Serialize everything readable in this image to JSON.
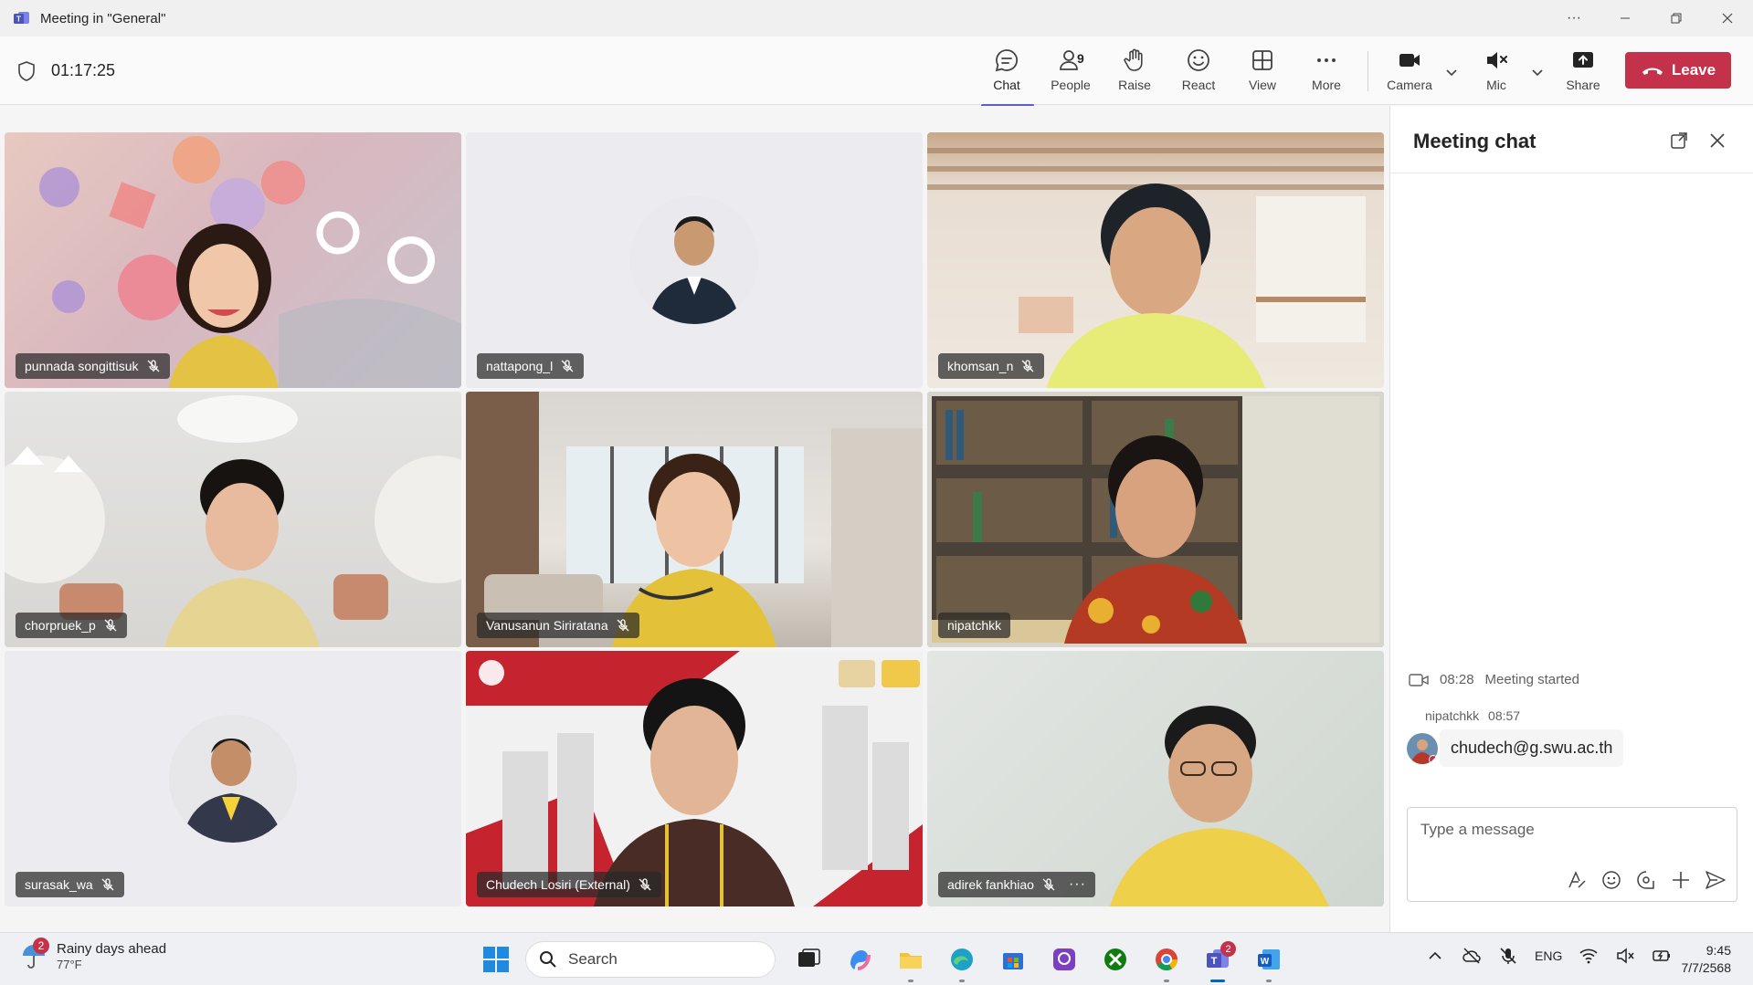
{
  "window": {
    "title": "Meeting in \"General\""
  },
  "toolbar": {
    "timer": "01:17:25",
    "buttons": {
      "chat": "Chat",
      "people": "People",
      "people_count": "9",
      "raise": "Raise",
      "react": "React",
      "view": "View",
      "more": "More",
      "camera": "Camera",
      "mic": "Mic",
      "share": "Share"
    },
    "leave": "Leave"
  },
  "participants": [
    {
      "name": "punnada songittisuk",
      "muted": true
    },
    {
      "name": "nattapong_l",
      "muted": true
    },
    {
      "name": "khomsan_n",
      "muted": true
    },
    {
      "name": "chorpruek_p",
      "muted": true
    },
    {
      "name": "Vanusanun Siriratana",
      "muted": true
    },
    {
      "name": "nipatchkk",
      "muted": false,
      "speaking": true
    },
    {
      "name": "surasak_wa",
      "muted": true
    },
    {
      "name": "Chudech Losiri (External)",
      "muted": true
    },
    {
      "name": "adirek fankhiao",
      "muted": true,
      "more": "···"
    }
  ],
  "chat": {
    "title": "Meeting chat",
    "system_time": "08:28",
    "system_text": "Meeting started",
    "messages": [
      {
        "sender": "nipatchkk",
        "time": "08:57",
        "text": "chudech@g.swu.ac.th"
      }
    ],
    "compose_placeholder": "Type a message"
  },
  "taskbar": {
    "weather_title": "Rainy days ahead",
    "weather_temp": "77°F",
    "weather_badge": "2",
    "search": "Search",
    "teams_badge": "2",
    "lang": "ENG",
    "time": "9:45",
    "date": "7/7/2568"
  },
  "colors": {
    "accent": "#5b5fc7",
    "leave": "#c4314b"
  }
}
